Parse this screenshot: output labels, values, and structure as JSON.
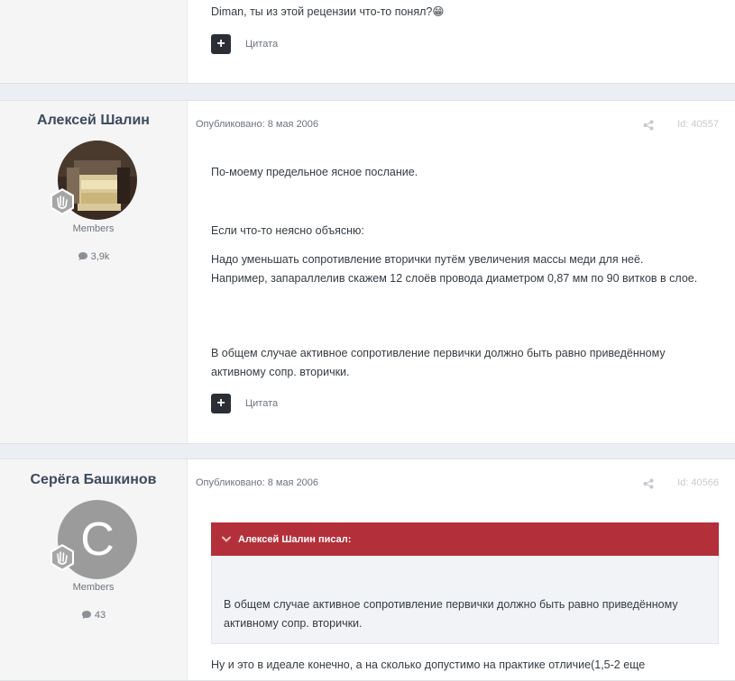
{
  "posts": [
    {
      "body": [
        "Diman, ты из этой рецензии что-то понял?😁"
      ],
      "quote_label": "Цитата"
    },
    {
      "author": "Алексей Шалин",
      "group": "Members",
      "post_count": "3,9k",
      "published": "Опубликовано: 8 мая 2006",
      "post_id": "Id: 40557",
      "body": [
        "По-моему предельное ясное послание.",
        "Если что-то неясно объясню:",
        "Надо уменьшать сопротивление вторички путём увеличения массы меди для неё. Например, запараллелив скажем 12 слоёв провода диаметром 0,87 мм по 90 витков в слое.",
        "В общем случае активное сопротивление первички должно быть равно приведённому активному сопр. вторички."
      ],
      "quote_label": "Цитата"
    },
    {
      "author": "Серёга Башкинов",
      "avatar_letter": "C",
      "group": "Members",
      "post_count": "43",
      "published": "Опубликовано: 8 мая 2006",
      "post_id": "Id: 40566",
      "blockquote": {
        "citation": "Алексей Шалин писал:",
        "text": "В общем случае активное сопротивление первички должно быть равно приведённому активному сопр. вторички."
      },
      "body": [
        "Ну и это в идеале конечно, а на сколько допустимо на практике отличие(1,5-2 еще"
      ]
    }
  ],
  "colors": {
    "page_bg": "#ebeef2",
    "author_panel_bg": "#f5f5f5",
    "quote_header_bg": "#b3303a",
    "quote_body_bg": "#f1f3f6",
    "avatar_placeholder": "#9b9b9b",
    "quote_button_bg": "#2a2f35"
  },
  "icons": {
    "badge": "hand-badge-icon",
    "post_count": "comment-icon",
    "share": "share-icon",
    "quote_add": "plus-icon",
    "citation": "chevron-down-icon"
  }
}
